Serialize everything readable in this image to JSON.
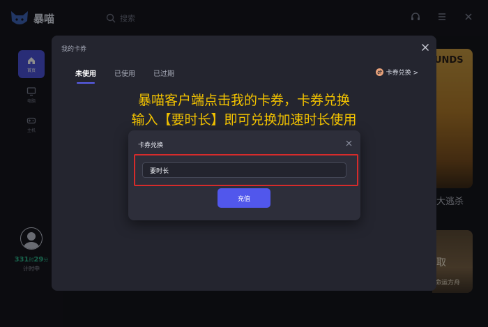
{
  "app": {
    "logo_text": "暴喵",
    "search_placeholder": "搜索"
  },
  "sidebar": {
    "items": [
      {
        "label": "首页",
        "icon": "home-icon",
        "active": true
      },
      {
        "label": "电脑",
        "icon": "monitor-icon",
        "active": false
      },
      {
        "label": "主机",
        "icon": "gamepad-icon",
        "active": false
      }
    ],
    "timer": {
      "hours": "331",
      "hours_unit": "时",
      "minutes": "29",
      "minutes_unit": "分",
      "label": "计时中"
    }
  },
  "background_games": {
    "card1_title": "UNDS",
    "card1_caption": "大逃杀",
    "card2_title": "取",
    "card2_sub": "命运方舟"
  },
  "dialog": {
    "title": "我的卡券",
    "tabs": [
      {
        "label": "未使用",
        "active": true
      },
      {
        "label": "已使用",
        "active": false
      },
      {
        "label": "已过期",
        "active": false
      }
    ],
    "redeem_link": "卡券兑换 >"
  },
  "annotation": {
    "line1": "暴喵客户端点击我的卡券，卡券兑换",
    "line2": "输入【要时长】即可兑换加速时长使用"
  },
  "redeem_modal": {
    "title": "卡券兑换",
    "input_value": "要时长",
    "submit_label": "充值"
  },
  "colors": {
    "accent": "#5157ec",
    "annotation": "#f2c200",
    "highlight": "#d62b2b",
    "timer": "#2db58b"
  }
}
